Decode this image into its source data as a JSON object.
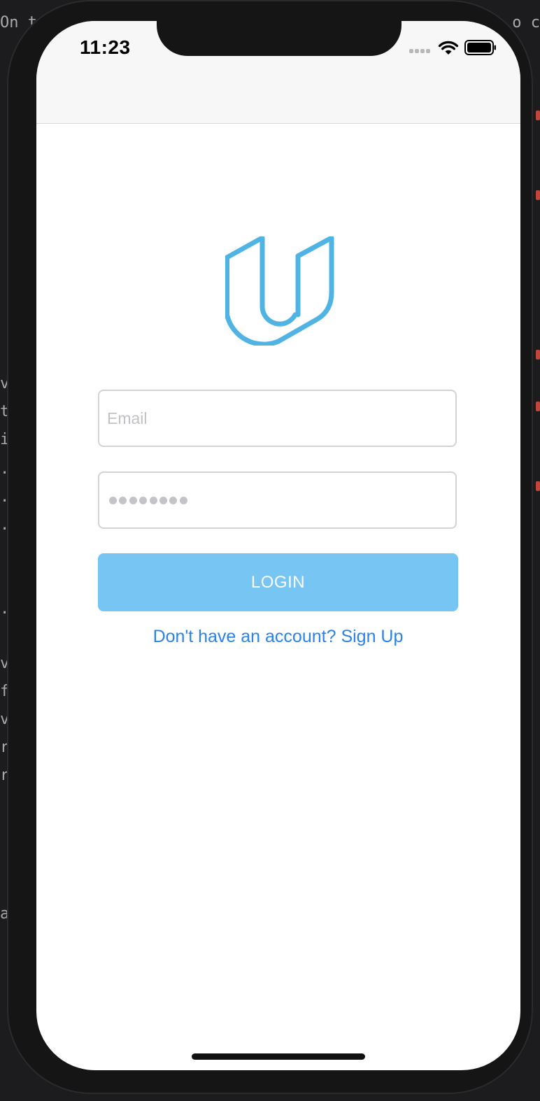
{
  "status_bar": {
    "time": "11:23"
  },
  "background": {
    "top_left_fragment": "On t",
    "top_right_fragment": "o c",
    "side_fragments": [
      "v",
      "t",
      "if",
      ".:",
      ".:",
      ".:",
      ".:",
      "vi",
      "ft",
      "vi",
      "r.",
      "r.",
      "a"
    ]
  },
  "login": {
    "email_placeholder": "Email",
    "password_masked_length": 8,
    "login_label": "LOGIN",
    "signup_label": "Don't have an account? Sign Up"
  },
  "colors": {
    "brand": "#4FB3E4",
    "button": "#76C5F3",
    "link": "#2A83E6"
  },
  "icons": [
    "udacity-logo",
    "signal-icon",
    "wifi-icon",
    "battery-icon"
  ]
}
